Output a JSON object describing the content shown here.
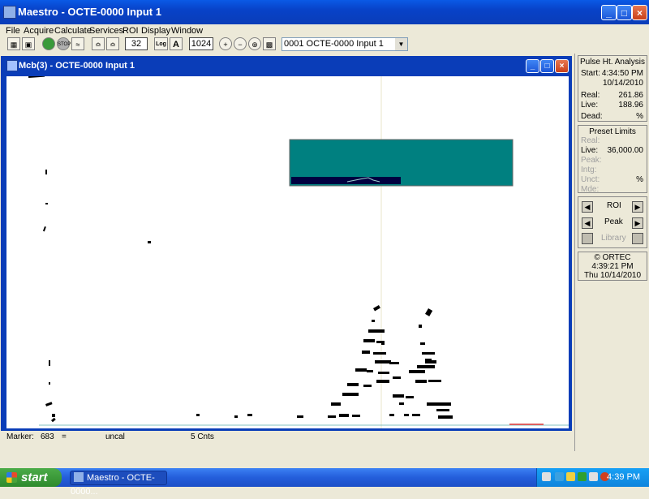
{
  "window": {
    "title": "Maestro - OCTE-0000 Input 1",
    "buttons": {
      "minimize": "_",
      "maximize": "□",
      "close": "×"
    }
  },
  "menu": [
    "File",
    "Acquire",
    "Calculate",
    "Services",
    "ROI",
    "Display",
    "Window"
  ],
  "toolbar": {
    "vertical_scale": "32",
    "log_label": "Log",
    "auto_label": "A",
    "horizontal_scale": "1024",
    "detector_select": "0001  OCTE-0000 Input 1"
  },
  "inner_window": {
    "title": "Mcb(3) - OCTE-0000 Input 1"
  },
  "marker_bar": {
    "marker_label": "Marker:",
    "marker_value": "683",
    "equals": "=",
    "calibration": "uncal",
    "counts": "5  Cnts"
  },
  "side_panel": {
    "pulse_title": "Pulse Ht. Analysis",
    "start_label": "Start:",
    "start_time": "4:34:50 PM",
    "start_date": "10/14/2010",
    "real_label": "Real:",
    "real_value": "261.86",
    "live_label": "Live:",
    "live_value": "188.96",
    "dead_label": "Dead:",
    "dead_unit": "%",
    "preset_title": "Preset Limits",
    "preset_real": "Real:",
    "preset_live_label": "Live:",
    "preset_live_value": "36,000.00",
    "preset_peak": "Peak:",
    "preset_intg": "Intg:",
    "preset_unct": "Unct:",
    "preset_unct_unit": "%",
    "preset_mde": "Mde:",
    "roi_label": "ROI",
    "peak_label": "Peak",
    "library_label": "Library",
    "ortec_label": "© ORTEC",
    "time": "4:39:21 PM",
    "day": "Thu",
    "date": "10/14/2010"
  },
  "taskbar": {
    "start_label": "start",
    "task_item": "Maestro - OCTE-0000...",
    "clock": "4:39 PM"
  },
  "colors": {
    "teal_inset": "#008080",
    "navy_inset": "#000040",
    "title_blue": "#0a3db8",
    "taskbar_blue": "#245edb"
  }
}
